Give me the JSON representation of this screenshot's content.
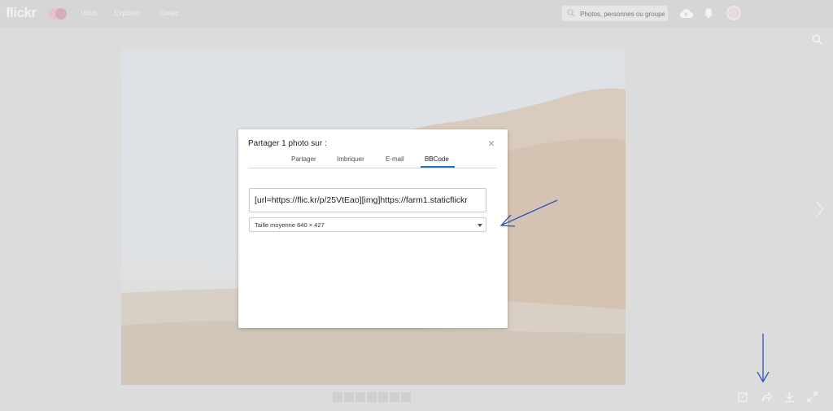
{
  "header": {
    "logo": "flickr",
    "nav": [
      {
        "label": "Vous"
      },
      {
        "label": "Explorer"
      },
      {
        "label": "Créez"
      }
    ],
    "search_placeholder": "Photos, personnes ou groupes"
  },
  "dialog": {
    "title": "Partager 1 photo sur :",
    "close": "×",
    "tabs": [
      {
        "label": "Partager"
      },
      {
        "label": "Imbriquer"
      },
      {
        "label": "E-mail"
      },
      {
        "label": "BBCode"
      }
    ],
    "active_tab": "BBCode",
    "code_value": "[url=https://flic.kr/p/25VtEao][img]https://farm1.staticflickr",
    "size_selected": "Taille moyenne 640 × 427"
  },
  "icons": {
    "upload": "cloud-upload-icon",
    "notifications": "bell-icon",
    "search": "search-icon",
    "edit": "edit-icon",
    "share": "share-icon",
    "download": "download-icon",
    "fullscreen": "fullscreen-icon"
  },
  "colors": {
    "accent": "#1c72c9",
    "annotation_arrow": "#2f54b5"
  }
}
